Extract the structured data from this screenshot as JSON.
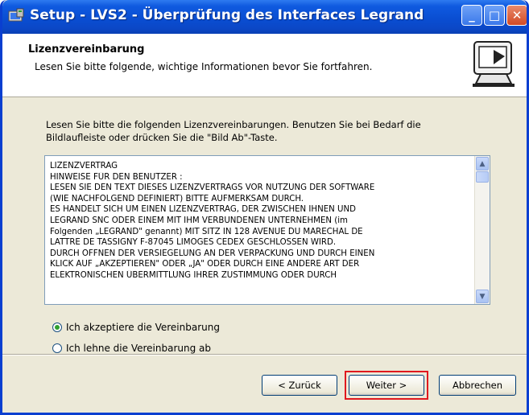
{
  "window": {
    "title": "Setup - LVS2 - Überprüfung des Interfaces Legrand",
    "controls": {
      "minimize": "_",
      "maximize": "□",
      "close": "✕"
    }
  },
  "header": {
    "title": "Lizenzvereinbarung",
    "subtitle": "Lesen Sie bitte folgende, wichtige Informationen bevor Sie fortfahren.",
    "logo_icon": "computer-setup-icon"
  },
  "content": {
    "intro": "Lesen Sie bitte die folgenden Lizenzvereinbarungen. Benutzen Sie bei Bedarf die Bildlaufleiste oder drücken Sie die \"Bild Ab\"-Taste.",
    "license_lines": [
      "LIZENZVERTRAG",
      "HINWEISE FÜR DEN BENUTZER :",
      "LESEN SIE DEN TEXT DIESES LIZENZVERTRAGS VOR NUTZUNG DER SOFTWARE",
      "(WIE NACHFOLGEND DEFINIERT) BITTE AUFMERKSAM DURCH.",
      "ES HANDELT SICH UM EINEN LIZENZVERTRAG, DER ZWISCHEN IHNEN UND",
      "LEGRAND SNC ODER EINEM MIT IHM VERBUNDENEN UNTERNEHMEN (im",
      "Folgenden „LEGRAND\" genannt) MIT SITZ IN 128 AVENUE DU MARECHAL DE",
      "LATTRE DE TASSIGNY F-87045 LIMOGES CEDEX GESCHLOSSEN WIRD.",
      "DURCH ÖFFNEN DER VERSIEGELUNG AN DER VERPACKUNG UND DURCH EINEN",
      "KLICK AUF „AKZEPTIEREN\" ODER „JA\" ODER DURCH EINE ANDERE ART DER",
      "ELEKTRONISCHEN ÜBERMITTLUNG IHRER ZUSTIMMUNG ODER DURCH"
    ],
    "radio_accept": "Ich akzeptiere die Vereinbarung",
    "radio_decline": "Ich lehne die Vereinbarung ab",
    "selected": "accept"
  },
  "buttons": {
    "back": "< Zurück",
    "next": "Weiter >",
    "cancel": "Abbrechen"
  },
  "colors": {
    "titlebar": "#0a4ed2",
    "dialog_bg": "#ece9d8",
    "highlight": "#e0191e",
    "radio_selected": "#2fa02f"
  }
}
